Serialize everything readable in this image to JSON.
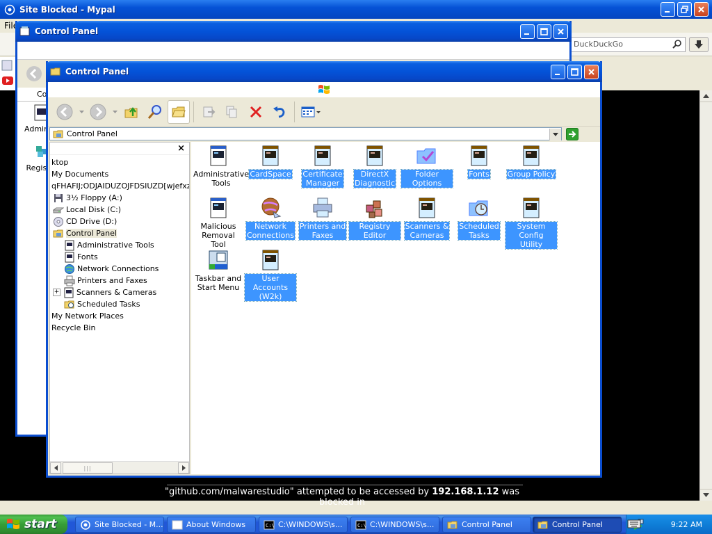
{
  "browser": {
    "title": "Site Blocked - Mypal",
    "menu_file": "File",
    "search_placeholder": "DuckDuckGo"
  },
  "blocked_message": {
    "prefix": "\"github.com/malwarestudio\" attempted to be accessed by ",
    "ip": "192.168.1.12",
    "suffix": " was blocked in"
  },
  "cp_back": {
    "title": "Control Panel",
    "address_stub": "Con",
    "items": [
      {
        "label": "Administrative Tools"
      },
      {
        "label": "Registry"
      }
    ]
  },
  "cp_front": {
    "title": "Control Panel",
    "address": "Control Panel",
    "tree": [
      {
        "label": "ktop",
        "icon": "none",
        "indent": 0
      },
      {
        "label": "My Documents",
        "icon": "none",
        "indent": 0
      },
      {
        "label": "qFHAFIJ;ODJAIDUZOJFDSIUZD[wjefxzvc",
        "icon": "none",
        "indent": 0
      },
      {
        "label": "3½ Floppy (A:)",
        "icon": "floppy-icon",
        "indent": 1
      },
      {
        "label": "Local Disk (C:)",
        "icon": "harddisk-icon",
        "indent": 1
      },
      {
        "label": "CD Drive (D:)",
        "icon": "cd-drive-icon",
        "indent": 1
      },
      {
        "label": "Control Panel",
        "icon": "control-panel-icon",
        "indent": 1,
        "selected": true
      },
      {
        "label": "Administrative Tools",
        "icon": "admin-tools-icon",
        "indent": 2
      },
      {
        "label": "Fonts",
        "icon": "fonts-icon",
        "indent": 2
      },
      {
        "label": "Network Connections",
        "icon": "network-icon",
        "indent": 2
      },
      {
        "label": "Printers and Faxes",
        "icon": "printer-icon",
        "indent": 2
      },
      {
        "label": "Scanners & Cameras",
        "icon": "scanner-icon",
        "indent": 2,
        "expander": "+"
      },
      {
        "label": "Scheduled Tasks",
        "icon": "scheduled-tasks-icon",
        "indent": 2
      },
      {
        "label": "My Network Places",
        "icon": "none",
        "indent": 0
      },
      {
        "label": "Recycle Bin",
        "icon": "none",
        "indent": 0
      }
    ],
    "icons": [
      {
        "line1": "Administrative",
        "line2": "Tools",
        "icon": "admin-tools-icon",
        "selected": false
      },
      {
        "line1": "CardSpace",
        "line2": "",
        "icon": "applet-icon",
        "selected": true
      },
      {
        "line1": "Certificate",
        "line2": "Manager",
        "icon": "applet-icon",
        "selected": true
      },
      {
        "line1": "DirectX",
        "line2": "Diagnostic",
        "icon": "applet-icon",
        "selected": true
      },
      {
        "line1": "Folder Options",
        "line2": "",
        "icon": "folder-options-icon",
        "selected": true
      },
      {
        "line1": "Fonts",
        "line2": "",
        "icon": "applet-icon",
        "selected": true
      },
      {
        "line1": "Group Policy",
        "line2": "",
        "icon": "applet-icon",
        "selected": true
      },
      {
        "line1": "Malicious",
        "line2": "Removal Tool",
        "icon": "applet-icon",
        "selected": false
      },
      {
        "line1": "Network",
        "line2": "Connections",
        "icon": "network-icon",
        "selected": true
      },
      {
        "line1": "Printers and",
        "line2": "Faxes",
        "icon": "printer-icon",
        "selected": true
      },
      {
        "line1": "Registry Editor",
        "line2": "",
        "icon": "registry-icon",
        "selected": true
      },
      {
        "line1": "Scanners &",
        "line2": "Cameras",
        "icon": "applet-icon",
        "selected": true
      },
      {
        "line1": "Scheduled",
        "line2": "Tasks",
        "icon": "scheduled-tasks-icon",
        "selected": true
      },
      {
        "line1": "System Config",
        "line2": "Utility",
        "icon": "applet-icon",
        "selected": true
      },
      {
        "line1": "Taskbar and",
        "line2": "Start Menu",
        "icon": "taskbar-icon",
        "selected": false
      },
      {
        "line1": "User Accounts",
        "line2": "(W2k)",
        "icon": "applet-icon",
        "selected": true
      }
    ]
  },
  "taskbar": {
    "start": "start",
    "tasks": [
      {
        "label": "Site Blocked - M...",
        "icon": "browser-icon",
        "active": false
      },
      {
        "label": "About Windows",
        "icon": "window-icon",
        "active": false
      },
      {
        "label": "C:\\WINDOWS\\s...",
        "icon": "cmd-icon",
        "active": false
      },
      {
        "label": "C:\\WINDOWS\\s...",
        "icon": "cmd-icon",
        "active": false
      },
      {
        "label": "Control Panel",
        "icon": "control-panel-icon",
        "active": false
      },
      {
        "label": "Control Panel",
        "icon": "control-panel-icon",
        "active": true
      }
    ],
    "clock": "9:22 AM"
  }
}
